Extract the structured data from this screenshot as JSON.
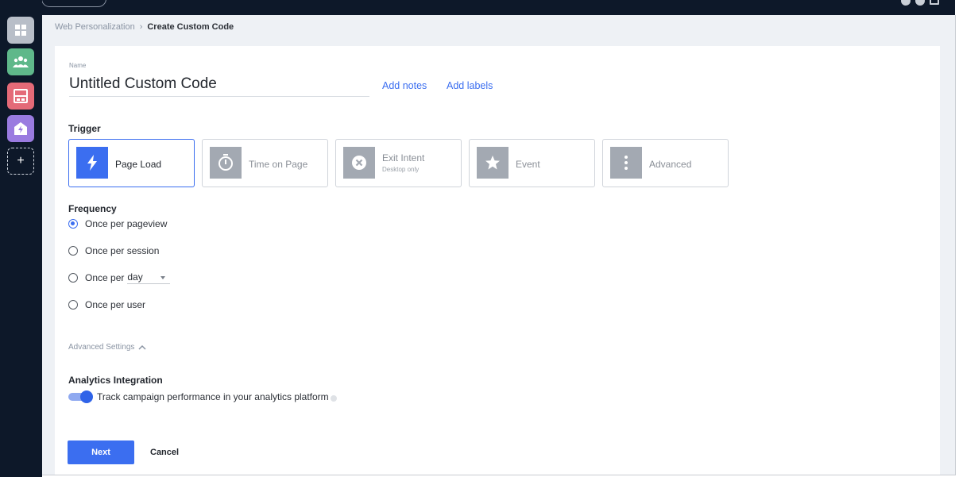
{
  "breadcrumb": {
    "parent": "Web Personalization",
    "separator": "›",
    "current": "Create Custom Code"
  },
  "rail": {
    "items": [
      {
        "icon": "grid-icon",
        "color": "#b8bec8"
      },
      {
        "icon": "people-icon",
        "color": "#5fb88a"
      },
      {
        "icon": "layout-icon",
        "color": "#e46a78"
      },
      {
        "icon": "email-bolt-icon",
        "color": "#9a7be0"
      }
    ],
    "add_label": "+"
  },
  "name": {
    "label": "Name",
    "value": "Untitled Custom Code"
  },
  "links": {
    "add_notes": "Add notes",
    "add_labels": "Add labels"
  },
  "trigger": {
    "title": "Trigger",
    "options": [
      {
        "label": "Page Load",
        "sub": "",
        "icon": "bolt-icon",
        "active": true
      },
      {
        "label": "Time on Page",
        "sub": "",
        "icon": "stopwatch-icon",
        "active": false
      },
      {
        "label": "Exit Intent",
        "sub": "Desktop only",
        "icon": "close-circle-icon",
        "active": false
      },
      {
        "label": "Event",
        "sub": "",
        "icon": "star-icon",
        "active": false
      },
      {
        "label": "Advanced",
        "sub": "",
        "icon": "more-vertical-icon",
        "active": false
      }
    ]
  },
  "frequency": {
    "title": "Frequency",
    "options": [
      {
        "label": "Once per pageview",
        "selected": true
      },
      {
        "label": "Once per session",
        "selected": false
      },
      {
        "label": "Once per",
        "selected": false,
        "select_value": "day"
      },
      {
        "label": "Once per user",
        "selected": false
      }
    ]
  },
  "advanced_settings": {
    "label": "Advanced Settings",
    "expanded": true
  },
  "analytics": {
    "title": "Analytics Integration",
    "toggle_label": "Track campaign performance in your analytics platform",
    "enabled": true
  },
  "actions": {
    "next": "Next",
    "cancel": "Cancel"
  },
  "colors": {
    "accent": "#3b6ef0",
    "nav_bg": "#0d1829",
    "content_bg": "#eef1f5"
  }
}
